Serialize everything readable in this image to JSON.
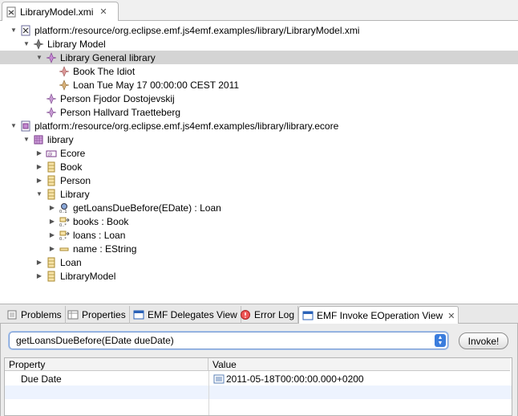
{
  "editor_tab": {
    "title": "LibraryModel.xmi"
  },
  "tree": [
    {
      "level": 0,
      "twisty": "open",
      "icon": "xmi-file-icon",
      "label": "platform:/resource/org.eclipse.emf.js4emf.examples/library/LibraryModel.xmi"
    },
    {
      "level": 1,
      "twisty": "open",
      "icon": "model-object-icon",
      "label": "Library Model"
    },
    {
      "level": 2,
      "twisty": "open",
      "icon": "library-object-icon",
      "label": "Library General library",
      "selected": true
    },
    {
      "level": 3,
      "twisty": "none",
      "icon": "book-object-icon",
      "label": "Book The Idiot"
    },
    {
      "level": 3,
      "twisty": "none",
      "icon": "loan-object-icon",
      "label": "Loan Tue May 17 00:00:00 CEST 2011"
    },
    {
      "level": 2,
      "twisty": "none",
      "icon": "person-object-icon",
      "label": "Person Fjodor Dostojevskij"
    },
    {
      "level": 2,
      "twisty": "none",
      "icon": "person-object-icon",
      "label": "Person Hallvard Traetteberg"
    },
    {
      "level": 0,
      "twisty": "open",
      "icon": "ecore-file-icon",
      "label": "platform:/resource/org.eclipse.emf.js4emf.examples/library/library.ecore"
    },
    {
      "level": 1,
      "twisty": "open",
      "icon": "package-icon",
      "label": "library"
    },
    {
      "level": 2,
      "twisty": "closed",
      "icon": "annotation-icon",
      "label": "Ecore"
    },
    {
      "level": 2,
      "twisty": "closed",
      "icon": "eclass-icon",
      "label": "Book"
    },
    {
      "level": 2,
      "twisty": "closed",
      "icon": "eclass-icon",
      "label": "Person"
    },
    {
      "level": 2,
      "twisty": "open",
      "icon": "eclass-icon",
      "label": "Library"
    },
    {
      "level": 3,
      "twisty": "closed",
      "icon": "eoperation-icon",
      "label": "getLoansDueBefore(EDate) : Loan"
    },
    {
      "level": 3,
      "twisty": "closed",
      "icon": "ereference-icon",
      "label": "books : Book"
    },
    {
      "level": 3,
      "twisty": "closed",
      "icon": "ereference-icon",
      "label": "loans : Loan"
    },
    {
      "level": 3,
      "twisty": "closed",
      "icon": "eattribute-icon",
      "label": "name : EString"
    },
    {
      "level": 2,
      "twisty": "closed",
      "icon": "eclass-icon",
      "label": "Loan"
    },
    {
      "level": 2,
      "twisty": "closed",
      "icon": "eclass-icon",
      "label": "LibraryModel"
    }
  ],
  "view_tabs": [
    {
      "label": "Problems",
      "icon": "problems-icon",
      "active": false
    },
    {
      "label": "Properties",
      "icon": "properties-icon",
      "active": false
    },
    {
      "label": "EMF Delegates View",
      "icon": "view-icon",
      "active": false
    },
    {
      "label": "Error Log",
      "icon": "error-log-icon",
      "active": false
    },
    {
      "label": "EMF Invoke EOperation View",
      "icon": "view-icon",
      "active": true
    }
  ],
  "operation_select": {
    "value": "getLoansDueBefore(EDate dueDate)"
  },
  "invoke_button": {
    "label": "Invoke!"
  },
  "params_table": {
    "columns": [
      "Property",
      "Value"
    ],
    "rows": [
      {
        "property": "Due Date",
        "value": "2011-05-18T00:00:00.000+0200"
      }
    ]
  },
  "colors": {
    "selection": "#d4d4d4",
    "accent": "#3b7ddd",
    "row_alt": "#edf3fe"
  }
}
